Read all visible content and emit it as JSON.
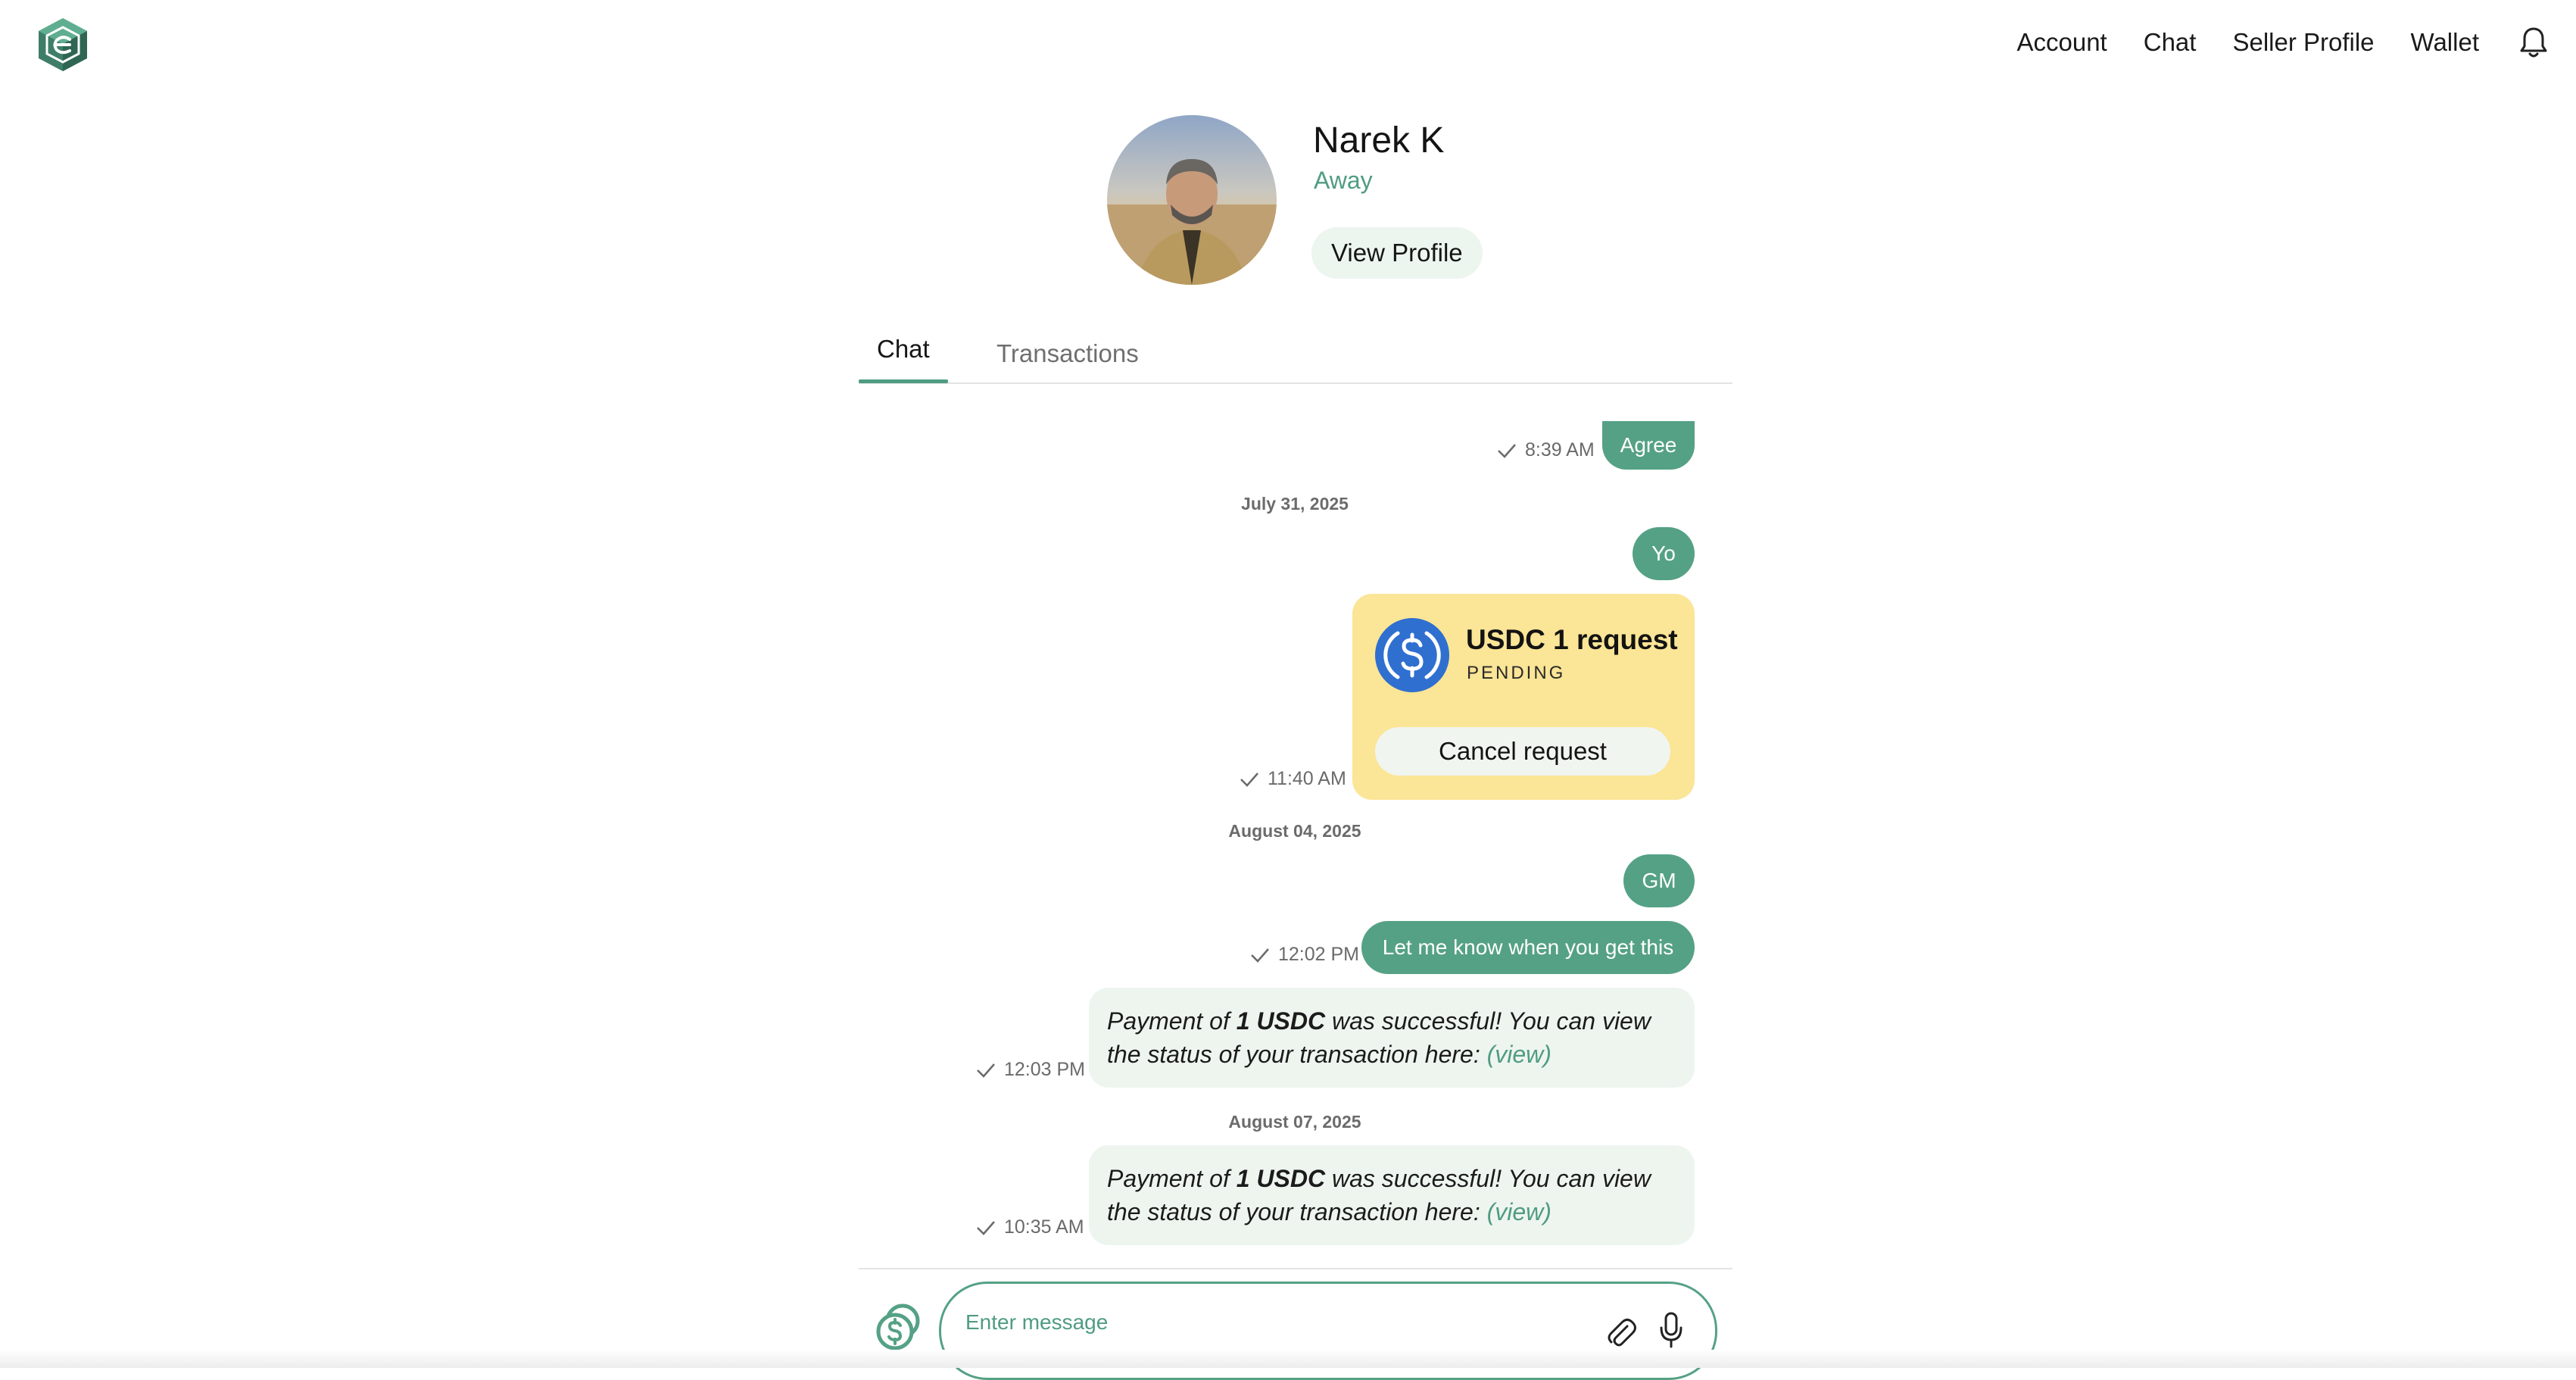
{
  "nav": {
    "items": [
      "Account",
      "Chat",
      "Seller Profile",
      "Wallet"
    ],
    "bell_icon": "bell-icon",
    "logo_icon": "hexagon-logo-icon"
  },
  "profile": {
    "name": "Narek K",
    "status": "Away",
    "view_profile_label": "View Profile"
  },
  "tabs": {
    "chat": "Chat",
    "transactions": "Transactions",
    "active": "Chat"
  },
  "messages": {
    "agree": {
      "text": "Agree",
      "time": "8:39 AM"
    },
    "date_1": "July 31, 2025",
    "yo": {
      "text": "Yo"
    },
    "request": {
      "title": "USDC 1 request",
      "status": "PENDING",
      "cancel_label": "Cancel request",
      "time": "11:40 AM"
    },
    "date_2": "August 04, 2025",
    "gm": {
      "text": "GM"
    },
    "letme": {
      "text": "Let me know when you get this",
      "time": "12:02 PM"
    },
    "payment_1": {
      "prefix": "Payment of ",
      "amount": "1 USDC",
      "line1_suffix": " was successful! You can view",
      "line2": "the status of your transaction here: ",
      "link": "(view)",
      "time": "12:03 PM"
    },
    "date_3": "August 07, 2025",
    "payment_2": {
      "prefix": "Payment of ",
      "amount": "1 USDC",
      "line1_suffix": " was successful! You can view",
      "line2": "the status of your transaction here: ",
      "link": "(view)",
      "time": "10:35 AM"
    }
  },
  "composer": {
    "placeholder": "Enter message",
    "value": ""
  },
  "colors": {
    "accent": "#55a186",
    "request_card": "#fbe596",
    "usdc_blue": "#2f6fcf",
    "received_bubble": "#eef5ef"
  }
}
